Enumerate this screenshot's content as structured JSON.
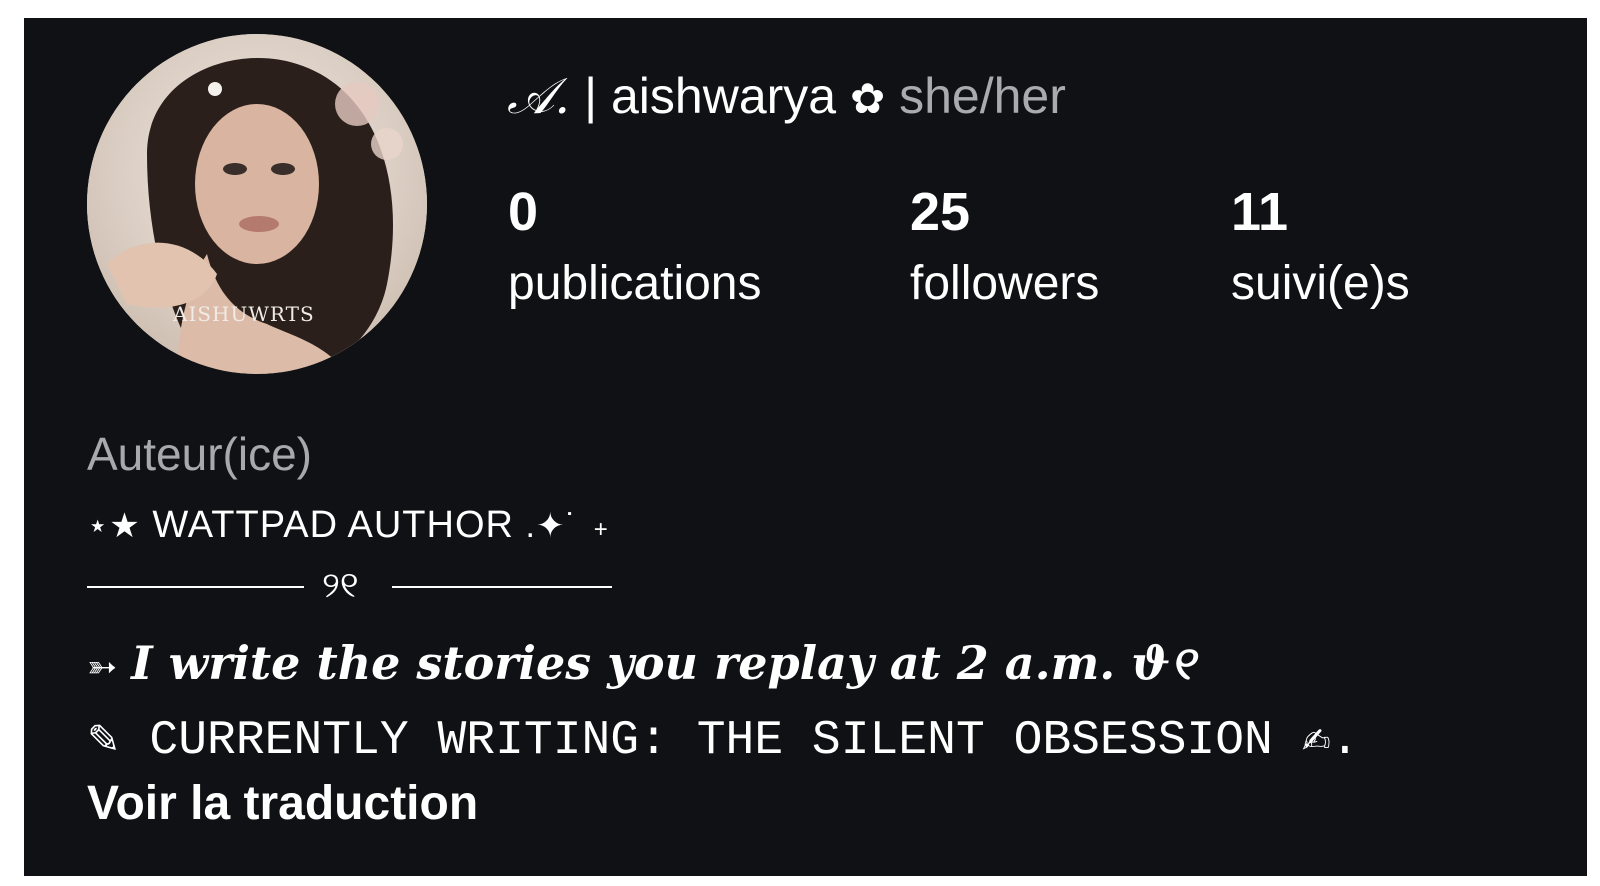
{
  "profile": {
    "avatar_watermark": "AISHUWRTS",
    "name_initial": "𝒜.",
    "name_main": "| aishwarya",
    "name_flower": "✿",
    "pronouns": "she/her"
  },
  "stats": [
    {
      "value": "0",
      "label": "publications"
    },
    {
      "value": "25",
      "label": "followers"
    },
    {
      "value": "11",
      "label": "suivi(e)s"
    }
  ],
  "bio": {
    "category": "Auteur(ice)",
    "line1_prefix": "⋆★",
    "line1_text": "WATTPAD AUTHOR",
    "line1_suffix": ".✦˙",
    "line1_plus": "+",
    "divider_glyph": "୨୧",
    "line3_arrow": "➳",
    "line3_text": "I write the stories you replay at 2 a.m. ϑ୧",
    "line4_pencil": "✎",
    "line4_text": "CURRENTLY WRITING: THE SILENT OBSESSION ✍︎."
  },
  "actions": {
    "translate_label": "Voir la traduction"
  }
}
